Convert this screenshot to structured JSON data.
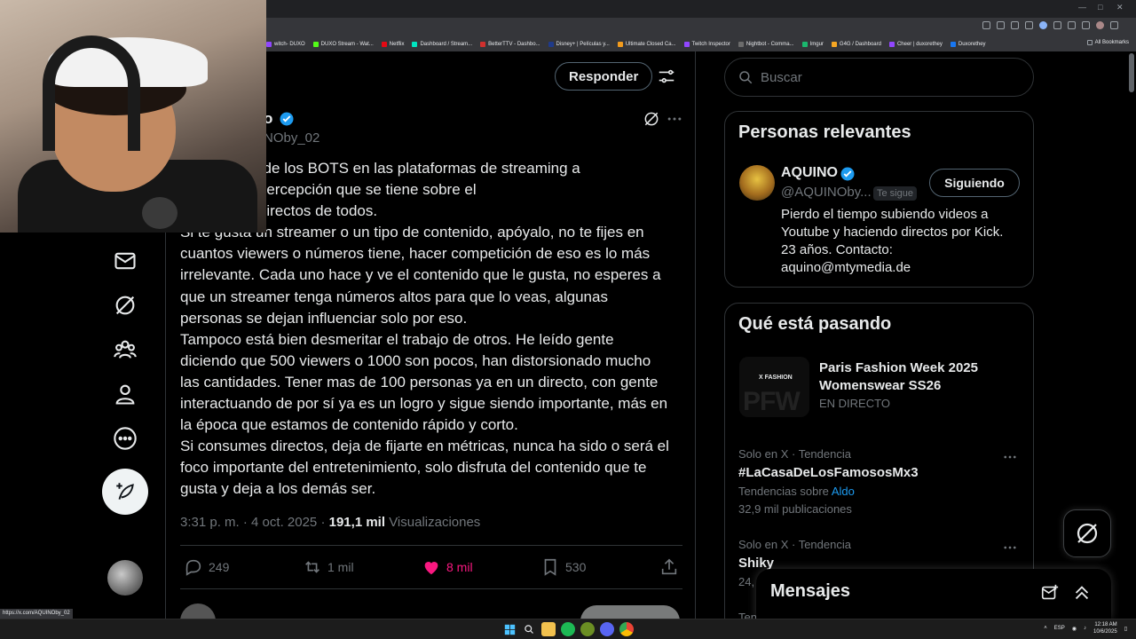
{
  "browser": {
    "bookmarks": [
      {
        "label": "witch- DUXO",
        "color": "#9146ff"
      },
      {
        "label": "DUXO Stream - Wat...",
        "color": "#53fc18"
      },
      {
        "label": "Netflix",
        "color": "#e50914"
      },
      {
        "label": "Dashboard / Stream...",
        "color": "#00e5c0"
      },
      {
        "label": "BetterTTV - Dashbo...",
        "color": "#d0302e"
      },
      {
        "label": "Disney+ | Películas y...",
        "color": "#1f3a8a"
      },
      {
        "label": "Ultimate Closed Ca...",
        "color": "#f29b1d"
      },
      {
        "label": "Twitch Inspector",
        "color": "#9146ff"
      },
      {
        "label": "Nightbot - Comma...",
        "color": "#6c6c6c"
      },
      {
        "label": "Imgur",
        "color": "#1bb76e"
      },
      {
        "label": "G4G / Dashboard",
        "color": "#f5a623"
      },
      {
        "label": "Cheer | duxorethey",
        "color": "#9146ff"
      },
      {
        "label": "Duxorethey",
        "color": "#1877f2"
      }
    ],
    "all_bookmarks": "All Bookmarks",
    "status_url": "https://x.com/AQUINOby_02"
  },
  "main": {
    "reply_button": "Responder",
    "author": {
      "name_visible": "o",
      "handle_visible": "NOby_02"
    },
    "tweet_lines": [
      "odo el tema de los BOTS en las plataformas de streaming a",
      "o mucho la percepción que se tiene sobre el",
      "ento en los directos de todos.",
      "Si te gusta un streamer o un tipo de contenido, apóyalo, no te fijes en",
      "cuantos viewers o números tiene, hacer competición de eso es lo más",
      "irrelevante. Cada uno hace y ve el contenido que le gusta, no esperes a",
      "que un streamer tenga números altos para que lo veas, algunas",
      "personas se dejan influenciar solo por eso.",
      "Tampoco está bien desmeritar el trabajo de otros. He leído gente",
      "diciendo que 500 viewers o 1000 son pocos, han distorsionado mucho",
      "las cantidades. Tener mas de 100 personas ya en un directo, con gente",
      "interactuando de por sí ya es un logro y sigue siendo importante, más en",
      "la época que estamos de contenido rápido y corto.",
      "Si consumes directos, deja de fijarte en métricas, nunca ha sido o será el",
      "foco importante del entretenimiento, solo disfruta del contenido que te",
      "gusta y deja a los demás ser."
    ],
    "meta": {
      "time": "3:31 p. m.",
      "sep": "·",
      "date": "4 oct. 2025",
      "views_count": "191,1 mil",
      "views_label": "Visualizaciones"
    },
    "actions": {
      "replies": "249",
      "reposts": "1 mil",
      "likes": "8 mil",
      "bookmarks": "530"
    }
  },
  "sidebar": {
    "search_placeholder": "Buscar",
    "relevant": {
      "title": "Personas relevantes",
      "name": "AQUINO",
      "handle": "@AQUINOby...",
      "follows_you": "Te sigue",
      "follow_button": "Siguiendo",
      "bio": "Pierdo el tiempo subiendo videos a Youtube y haciendo directos por Kick. 23 años. Contacto: aquino@mtymedia.de"
    },
    "trends": {
      "title": "Qué está pasando",
      "featured": {
        "image_label": "X FASHION",
        "image_big": "PFW",
        "title": "Paris Fashion Week 2025 Womenswear SS26",
        "status": "EN DIRECTO"
      },
      "items": [
        {
          "meta": "Solo en X · Tendencia",
          "name": "#LaCasaDeLosFamososMx3",
          "sub_prefix": "Tendencias sobre",
          "sub_link": "Aldo",
          "posts": "32,9 mil publicaciones"
        },
        {
          "meta": "Solo en X · Tendencia",
          "name": "Shiky",
          "posts": "24,"
        }
      ],
      "cut_off": "Ten"
    }
  },
  "messages": {
    "title": "Mensajes"
  },
  "taskbar": {
    "lang": "ESP",
    "time": "12:18 AM",
    "date": "10/6/2025"
  },
  "colors": {
    "accent": "#1d9bf0",
    "like": "#f91880",
    "background": "#000000",
    "border": "#2f3336",
    "muted": "#71767b"
  }
}
